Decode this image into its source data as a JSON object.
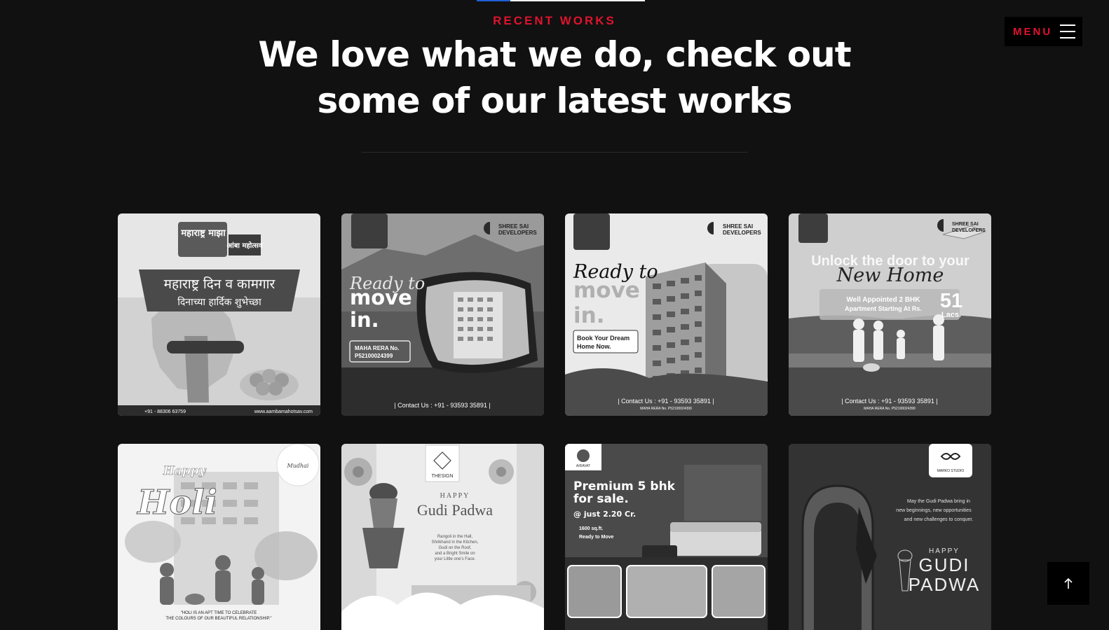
{
  "header": {
    "eyebrow": "RECENT WORKS",
    "title_line1": "We love what we do, check out",
    "title_line2": "some of our latest works"
  },
  "menu": {
    "label": "MENU",
    "icon": "hamburger-icon"
  },
  "back_to_top": {
    "icon": "arrow-up-icon",
    "glyph": "↑"
  },
  "works": [
    {
      "name": "aamba-mahotsav-maharashtra-day",
      "texts": [
        "महाराष्ट्र माझा",
        "आंबा महोत्सव",
        "महाराष्ट्र दिन व कामगार",
        "दिनाच्या हार्दिक शुभेच्छा",
        "+91 - 88306 63759",
        "www.aambamahotsav.com"
      ]
    },
    {
      "name": "shree-sai-ready-to-move-mirror",
      "texts": [
        "SHREE SAI",
        "DEVELOPERS",
        "Ready to",
        "move",
        "in.",
        "MAHA RERA No.",
        "P52100024399",
        "| Contact Us : +91 - 93593 35891 |"
      ]
    },
    {
      "name": "shree-sai-ready-to-move-building",
      "texts": [
        "SHREE SAI",
        "DEVELOPERS",
        "Ready to",
        "move",
        "in.",
        "Book Your Dream",
        "Home Now.",
        "| Contact Us : +91 - 93593 35891 |",
        "MAHA RERA No. P52100024399"
      ]
    },
    {
      "name": "shree-sai-new-home-family",
      "texts": [
        "SHREE SAI",
        "DEVELOPERS",
        "Unlock the door to your",
        "New Home",
        "Well Appointed 2 BHK",
        "Apartment Starting At Rs.",
        "51",
        "Lacs.",
        "| Contact Us : +91 - 93593 35891 |",
        "MAHA RERA No. P52100024399"
      ]
    },
    {
      "name": "happy-holi",
      "texts": [
        "Happy",
        "Holi",
        "\"HOLI IS AN APT TIME TO CELEBRATE",
        "THE COLOURS OF OUR BEAUTIFUL RELATIONSHIP.\""
      ]
    },
    {
      "name": "thesign-gudi-padwa",
      "texts": [
        "THESIGN",
        "HAPPY",
        "Gudi Padwa",
        "Rangoli in the Hall,",
        "Shrikhand in the Kitchen,",
        "Gudi on the Roof,",
        "and a Bright Smile on",
        "your Little one's Face."
      ]
    },
    {
      "name": "airavat-premium-5bhk",
      "texts": [
        "AIRAVAT",
        "Premium 5 bhk",
        "for sale.",
        "@ just 2.20 Cr.",
        "1600 sq.ft.",
        "Ready to Move"
      ]
    },
    {
      "name": "marko-studio-gudi-padwa",
      "texts": [
        "MARKO STUDIO",
        "May the Gudi Padwa bring in",
        "new beginnings, new opportunities",
        "and new challenges to conquer.",
        "HAPPY",
        "GUDI",
        "PADWA"
      ]
    }
  ]
}
